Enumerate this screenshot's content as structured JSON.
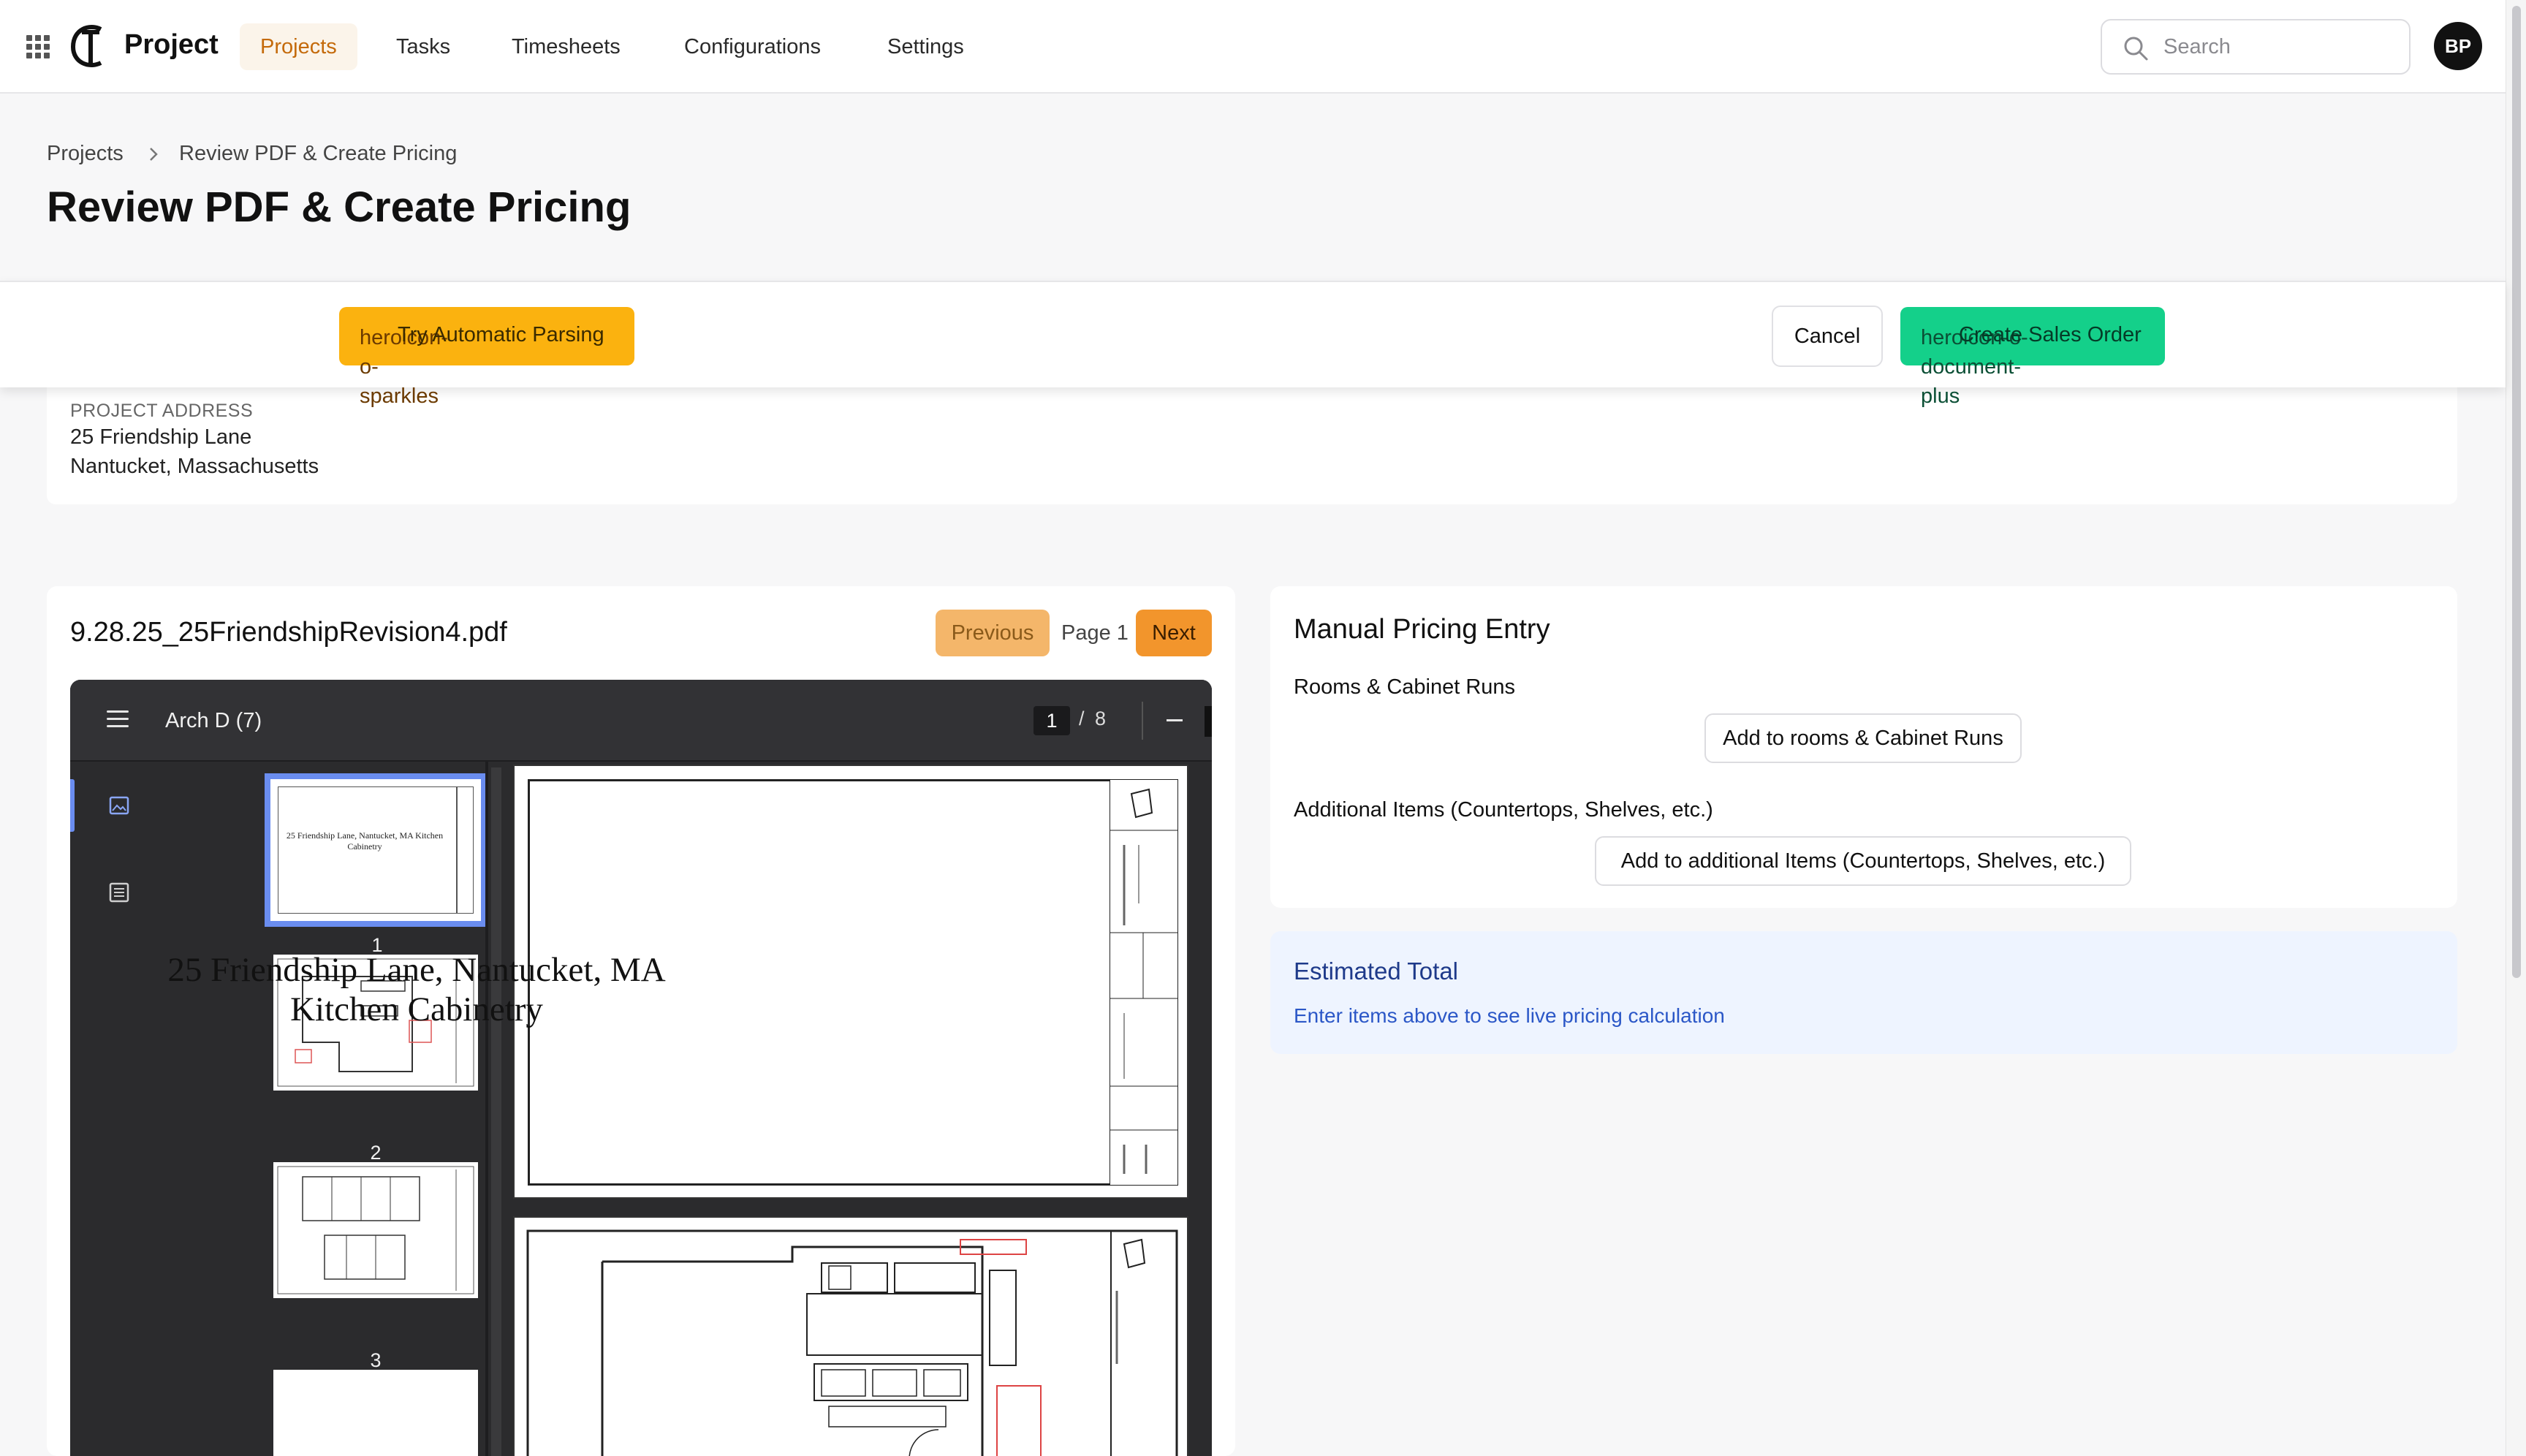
{
  "nav": {
    "app_name": "Project",
    "items": [
      {
        "label": "Projects",
        "active": true
      },
      {
        "label": "Tasks",
        "active": false
      },
      {
        "label": "Timesheets",
        "active": false
      },
      {
        "label": "Configurations",
        "active": false
      },
      {
        "label": "Settings",
        "active": false
      }
    ],
    "search_placeholder": "Search",
    "avatar_initials": "BP",
    "accent_color": "#c46a0b"
  },
  "header": {
    "breadcrumb": [
      "Projects",
      "Review PDF & Create Pricing"
    ],
    "title": "Review PDF & Create Pricing"
  },
  "actions": {
    "auto_parse_label": "Try Automatic Parsing",
    "auto_parse_icon": "heroicon-o-sparkles",
    "cancel_label": "Cancel",
    "sales_order_label": "Create Sales Order",
    "sales_order_icon": "heroicon-o-document-plus"
  },
  "project": {
    "address_label": "PROJECT ADDRESS",
    "address_line1": "25 Friendship Lane",
    "address_line2": "Nantucket, Massachusetts"
  },
  "pdf": {
    "filename": "9.28.25_25FriendshipRevision4.pdf",
    "prev_label": "Previous",
    "page_label": "Page 1",
    "next_label": "Next",
    "viewer": {
      "doc_title": "Arch D (7)",
      "current_page": "1",
      "separator": "/",
      "total_pages": "8",
      "thumbnails": [
        "1",
        "2",
        "3"
      ],
      "thumb1_text": "25 Friendship Lane, Nantucket, MA Kitchen Cabinetry",
      "page1_line1": "25 Friendship Lane, Nantucket, MA",
      "page1_line2": "Kitchen Cabinetry"
    }
  },
  "pricing": {
    "title": "Manual Pricing Entry",
    "rooms_label": "Rooms & Cabinet Runs",
    "add_rooms_button": "Add to rooms & Cabinet Runs",
    "additional_label": "Additional Items (Countertops, Shelves, etc.)",
    "add_additional_button": "Add to additional Items (Countertops, Shelves, etc.)"
  },
  "estimate": {
    "title": "Estimated Total",
    "subtitle": "Enter items above to see live pricing calculation"
  }
}
